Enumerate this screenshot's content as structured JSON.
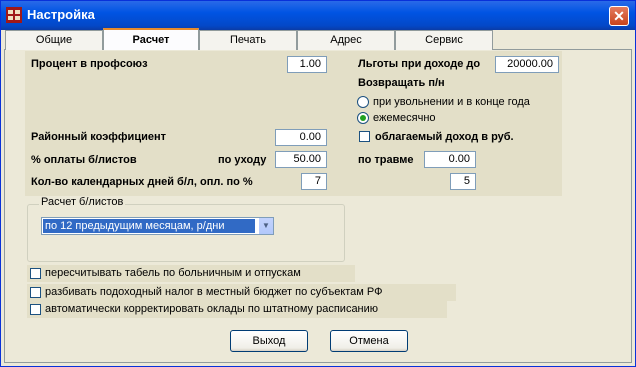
{
  "window": {
    "title": "Настройка",
    "close_glyph": "✕"
  },
  "tabs": [
    {
      "label": "Общие"
    },
    {
      "label": "Расчет"
    },
    {
      "label": "Печать"
    },
    {
      "label": "Адрес"
    },
    {
      "label": "Сервис"
    }
  ],
  "active_tab": "Расчет",
  "calc": {
    "union_label": "Процент в профсоюз",
    "union_value": "1.00",
    "benefit_label": "Льготы при доходе до",
    "benefit_value": "20000.00",
    "return_label": "Возвращать п/н",
    "radio_dismissal": "при увольнении и в конце года",
    "radio_monthly": "ежемесячно",
    "radio_selected": "ежемесячно",
    "regional_label": "Районный коэффициент",
    "regional_value": "0.00",
    "taxable_label": "облагаемый доход в руб.",
    "taxable_checked": false,
    "sick_pay_label": "% оплаты б/листов",
    "care_label": "по уходу",
    "care_value": "50.00",
    "injury_label": "по травме",
    "injury_value": "0.00",
    "days_label": "Кол-во календарных дней б/л, опл. по %",
    "days_value": "7",
    "injury_days_value": "5"
  },
  "sick_group": {
    "title": "Расчет б/листов",
    "selected": "по 12 предыдущим месяцам, р/дни",
    "arrow": "▼"
  },
  "options": [
    {
      "label": "пересчитывать табель по больничным и отпускам",
      "checked": false
    },
    {
      "label": "разбивать подоходный налог в местный бюджет по субъектам РФ",
      "checked": false
    },
    {
      "label": "автоматически корректировать оклады по штатному расписанию",
      "checked": false
    }
  ],
  "buttons": {
    "exit": "Выход",
    "cancel": "Отмена"
  },
  "icons": {
    "app": "app-window-icon",
    "close": "close-icon"
  },
  "colors": {
    "title_bar": "#0054e3",
    "close_button": "#d3532d",
    "panel_bg": "#ece9d8",
    "section_bg": "#e3dfc8",
    "selection": "#316ac5",
    "radio_dot": "#21a121"
  }
}
